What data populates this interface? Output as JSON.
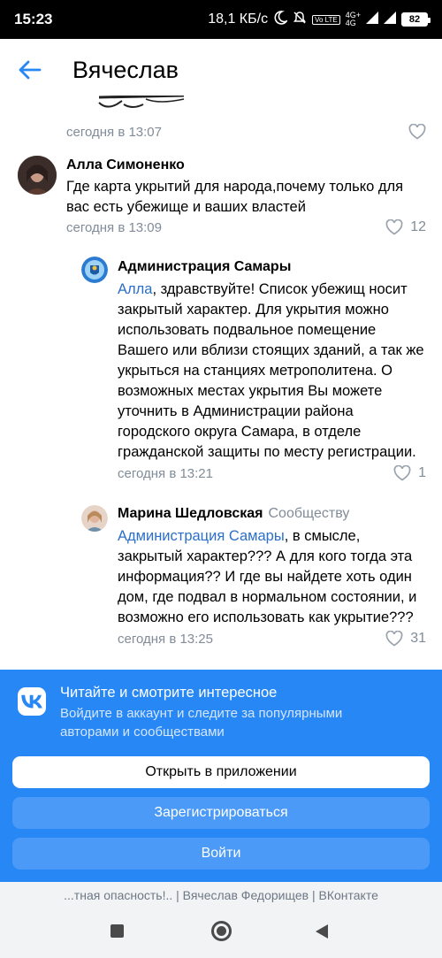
{
  "status_bar": {
    "time": "15:23",
    "speed": "18,1 КБ/с",
    "volte_badge": "Vo LTE",
    "network_top": "4G+",
    "network_bottom": "4G",
    "battery": "82",
    "icons": [
      "moon-icon",
      "muted-bell-icon",
      "signal-icon",
      "signal-icon"
    ]
  },
  "header": {
    "title": "Вячеслав",
    "back_icon": "arrow-left-icon"
  },
  "comments": [
    {
      "time": "сегодня в 13:07",
      "likes": ""
    },
    {
      "author": "Алла Симоненко",
      "text": "Где карта укрытий для народа,почему только для вас есть убежище и ваших властей",
      "time": "сегодня в 13:09",
      "likes": "12"
    },
    {
      "author": "Администрация Самары",
      "mention": "Алла",
      "text": ", здравствуйте! Список убежищ носит закрытый характер. Для укрытия можно использовать подвальное помещение Вашего или вблизи стоящих зданий, а так же укрыться на станциях метрополитена. О возможных местах укрытия Вы можете уточнить в Администрации района городского округа Самара, в отделе гражданской защиты по месту регистрации.",
      "time": "сегодня в 13:21",
      "likes": "1"
    },
    {
      "author": "Марина Шедловская",
      "reply_to": "Сообществу",
      "mention": "Администрация Самары",
      "text": ", в смысле, закрытый характер??? А для кого тогда эта информация?? И где вы найдете хоть один дом, где подвал в нормальном состоянии, и возможно его использовать как укрытие???",
      "time": "сегодня в 13:25",
      "likes": "31"
    }
  ],
  "banner": {
    "title": "Читайте и смотрите интересное",
    "subtitle": "Войдите в аккаунт и следите за популярными авторами и сообществами",
    "open_app": "Открыть в приложении",
    "register": "Зарегистрироваться",
    "login": "Войти",
    "color": "#2787f5"
  },
  "footer": {
    "text": "...тная опасность!.. | Вячеслав Федорищев | ВКонтакте"
  },
  "colors": {
    "link": "#2a6fc9",
    "meta": "#818c99",
    "accent": "#2787f5"
  }
}
